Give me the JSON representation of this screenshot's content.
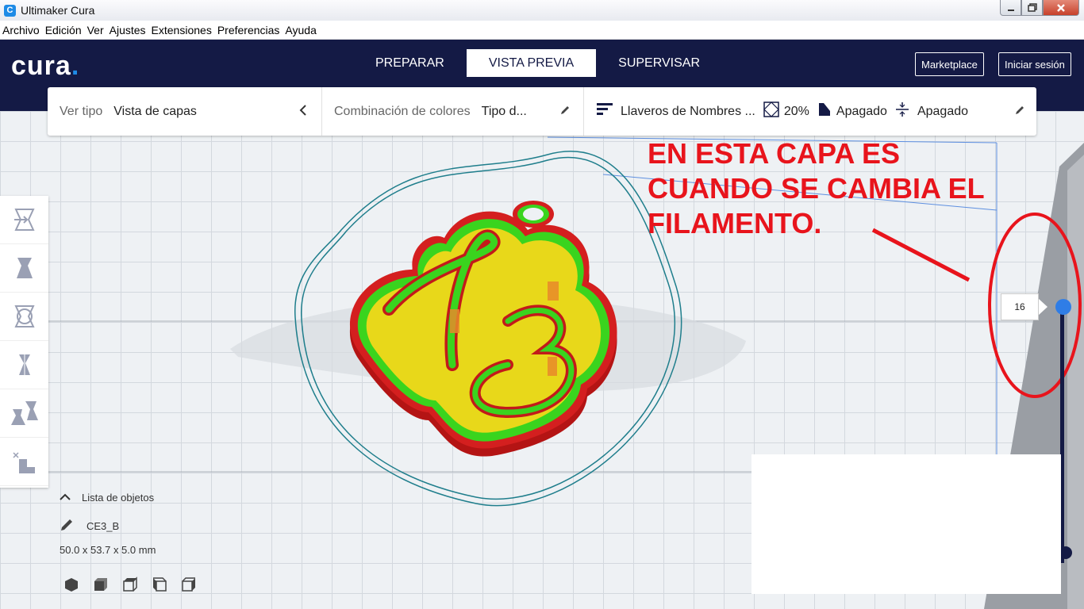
{
  "window": {
    "title": "Ultimaker Cura",
    "app_icon": "C"
  },
  "menubar": {
    "items": [
      "Archivo",
      "Edición",
      "Ver",
      "Ajustes",
      "Extensiones",
      "Preferencias",
      "Ayuda"
    ]
  },
  "header": {
    "logo": "cura",
    "logo_dot": ".",
    "tabs": [
      {
        "label": "PREPARAR",
        "active": false
      },
      {
        "label": "VISTA PREVIA",
        "active": true
      },
      {
        "label": "SUPERVISAR",
        "active": false
      }
    ],
    "marketplace_label": "Marketplace",
    "signin_label": "Iniciar sesión"
  },
  "toolbar": {
    "view_type_label": "Ver tipo",
    "view_type_value": "Vista de capas",
    "color_scheme_label": "Combinación de colores",
    "color_scheme_value": "Tipo d...",
    "profile_name": "Llaveros de Nombres ...",
    "infill": "20%",
    "support": "Apagado",
    "adhesion": "Apagado"
  },
  "objects": {
    "list_label": "Lista de objetos",
    "object_name": "CE3_B",
    "dimensions": "50.0 x 53.7 x 5.0 mm"
  },
  "annotation": {
    "text": "EN ESTA CAPA ES CUANDO SE CAMBIA EL FILAMENTO."
  },
  "layer_slider": {
    "current_layer": "16"
  },
  "colors": {
    "header_bg": "#141a45",
    "accent": "#1e8be6",
    "annotation": "#e8141c",
    "model_wall": "#c21a1a",
    "model_inner": "#3ad41e",
    "model_infill": "#e8d81a"
  }
}
